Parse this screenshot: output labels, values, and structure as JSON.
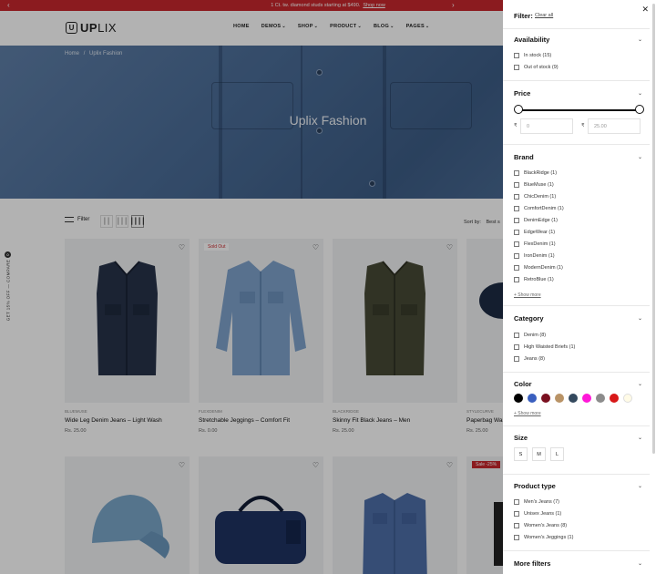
{
  "announcement": {
    "text": "1 Ct. tw. diamond studs starting at $490.",
    "link": "Shop now"
  },
  "logo": {
    "letter": "U",
    "bold": "UP",
    "rest": "LIX"
  },
  "nav": [
    {
      "label": "HOME",
      "dropdown": false
    },
    {
      "label": "DEMOS",
      "dropdown": true
    },
    {
      "label": "SHOP",
      "dropdown": true
    },
    {
      "label": "PRODUCT",
      "dropdown": true
    },
    {
      "label": "BLOG",
      "dropdown": true
    },
    {
      "label": "PAGES",
      "dropdown": true
    }
  ],
  "breadcrumb": {
    "home": "Home",
    "sep": "/",
    "current": "Uplix Fashion"
  },
  "hero_title": "Uplix Fashion",
  "toolbar": {
    "filter_label": "Filter",
    "sort_label": "Sort by:",
    "sort_value": "Best s"
  },
  "compare": {
    "text": "GET 15% OFF  —  COMPARE",
    "count": "0"
  },
  "products": [
    {
      "brand": "BLUEMUSE",
      "name": "Wide Leg Denim Jeans – Light Wash",
      "price": "Rs. 25.00",
      "badge": "",
      "image": "vest-dark"
    },
    {
      "brand": "FLEXDENIM",
      "name": "Stretchable Jeggings – Comfort Fit",
      "price": "Rs. 0.00",
      "badge": "Sold Out",
      "image": "jacket-light"
    },
    {
      "brand": "BLACKRIDGE",
      "name": "Skinny Fit Black Jeans – Men",
      "price": "Rs. 25.00",
      "badge": "",
      "image": "vest-olive"
    },
    {
      "brand": "STYLECURVE",
      "name": "Paperbag Waist",
      "price": "Rs. 25.00",
      "badge": "",
      "image": "cap-partial"
    },
    {
      "brand": "",
      "name": "",
      "price": "",
      "badge": "",
      "image": "cap-denim"
    },
    {
      "brand": "",
      "name": "",
      "price": "",
      "badge": "",
      "image": "duffel-bag"
    },
    {
      "brand": "",
      "name": "",
      "price": "",
      "badge": "",
      "image": "shirt-denim"
    },
    {
      "brand": "",
      "name": "",
      "price": "",
      "badge": "Sale -25%",
      "image": "item-partial"
    }
  ],
  "filter": {
    "title": "Filter:",
    "clear": "Clear all",
    "availability": {
      "title": "Availability",
      "options": [
        "In stock (15)",
        "Out of stock (9)"
      ]
    },
    "price": {
      "title": "Price",
      "currency": "₹",
      "min_placeholder": "0",
      "max_placeholder": "25.00"
    },
    "brand": {
      "title": "Brand",
      "options": [
        "BlackRidge (1)",
        "BlueMuse (1)",
        "ChicDenim (1)",
        "ComfortDenim (1)",
        "DenimEdge (1)",
        "EdgeWear (1)",
        "FlexDenim (1)",
        "IronDenim (1)",
        "ModernDenim (1)",
        "RetroBlue (1)"
      ],
      "more": "+ Show more"
    },
    "category": {
      "title": "Category",
      "options": [
        "Denim (8)",
        "High Waisted Briefs (1)",
        "Jeans (8)"
      ]
    },
    "color": {
      "title": "Color",
      "swatches": [
        "#000000",
        "#3a5fbf",
        "#7a1020",
        "#b99366",
        "#34495e",
        "#ff18d8",
        "#8c8c8c",
        "#d81818",
        "#fffbe6"
      ],
      "more": "+ Show more"
    },
    "size": {
      "title": "Size",
      "options": [
        "S",
        "M",
        "L"
      ]
    },
    "product_type": {
      "title": "Product type",
      "options": [
        "Men's Jeans (7)",
        "Unisex Jeans (1)",
        "Women's Jeans (8)",
        "Women's Jeggings (1)"
      ]
    },
    "more_filters": {
      "title": "More filters"
    }
  }
}
